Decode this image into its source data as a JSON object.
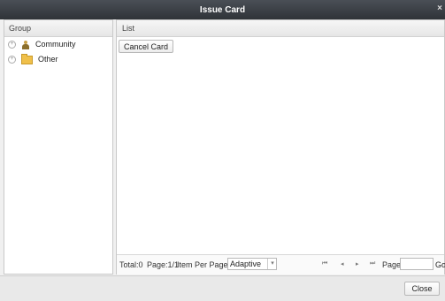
{
  "window": {
    "title": "Issue Card",
    "close_glyph": "×"
  },
  "group_panel": {
    "header": "Group",
    "items": [
      {
        "label": "Community",
        "icon": "person-icon"
      },
      {
        "label": "Other",
        "icon": "folder-icon"
      }
    ]
  },
  "list_panel": {
    "header": "List",
    "toolbar": {
      "cancel_card_label": "Cancel Card"
    },
    "pager": {
      "total_text": "Total:0",
      "page_text": "Page:1/1",
      "items_per_page_label": "Item Per Page:",
      "items_per_page_value": "Adaptive",
      "first_glyph": "⏮",
      "prev_glyph": "◂",
      "next_glyph": "▸",
      "last_glyph": "⏭",
      "page_label": "Page",
      "go_label": "Go"
    }
  },
  "footer": {
    "close_label": "Close"
  }
}
